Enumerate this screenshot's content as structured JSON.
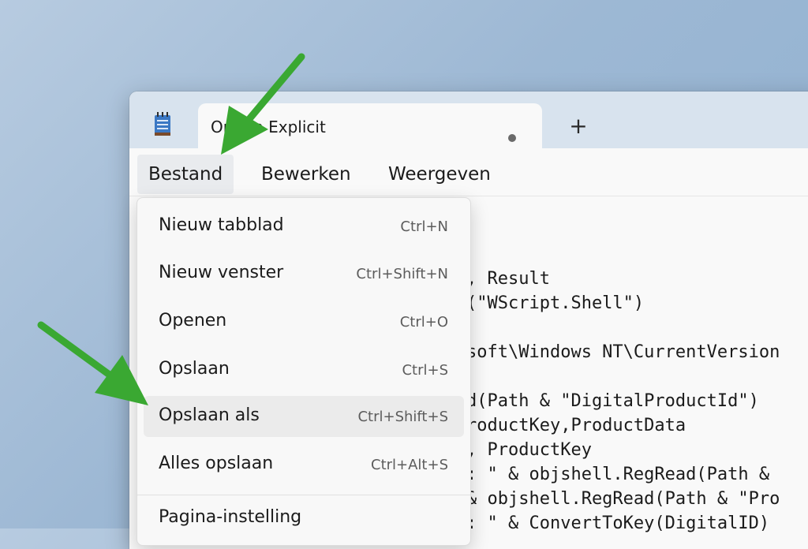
{
  "window": {
    "tab_title": "Option Explicit",
    "new_tab_symbol": "+"
  },
  "menubar": {
    "items": [
      "Bestand",
      "Bewerken",
      "Weergeven"
    ]
  },
  "file_menu": {
    "items": [
      {
        "label": "Nieuw tabblad",
        "shortcut": "Ctrl+N"
      },
      {
        "label": "Nieuw venster",
        "shortcut": "Ctrl+Shift+N"
      },
      {
        "label": "Openen",
        "shortcut": "Ctrl+O"
      },
      {
        "label": "Opslaan",
        "shortcut": "Ctrl+S"
      },
      {
        "label": "Opslaan als",
        "shortcut": "Ctrl+Shift+S"
      },
      {
        "label": "Alles opslaan",
        "shortcut": "Ctrl+Alt+S"
      },
      {
        "label": "Pagina-instelling",
        "shortcut": ""
      }
    ]
  },
  "editor": {
    "lines": [
      ", Result",
      "(\"WScript.Shell\")",
      "",
      "soft\\Windows NT\\CurrentVersion",
      "",
      "d(Path & \"DigitalProductId\")",
      "roductKey,ProductData",
      ", ProductKey",
      ": \" & objshell.RegRead(Path &",
      "& objshell.RegRead(Path & \"Pro",
      ": \" & ConvertToKey(DigitalID)"
    ]
  },
  "colors": {
    "arrow": "#3aa832",
    "titlebar": "#d8e3ee",
    "accent_hover": "#ebebeb"
  },
  "icons": {
    "app": "notepad-icon",
    "unsaved": "unsaved-dot-icon",
    "new_tab": "plus-icon"
  }
}
